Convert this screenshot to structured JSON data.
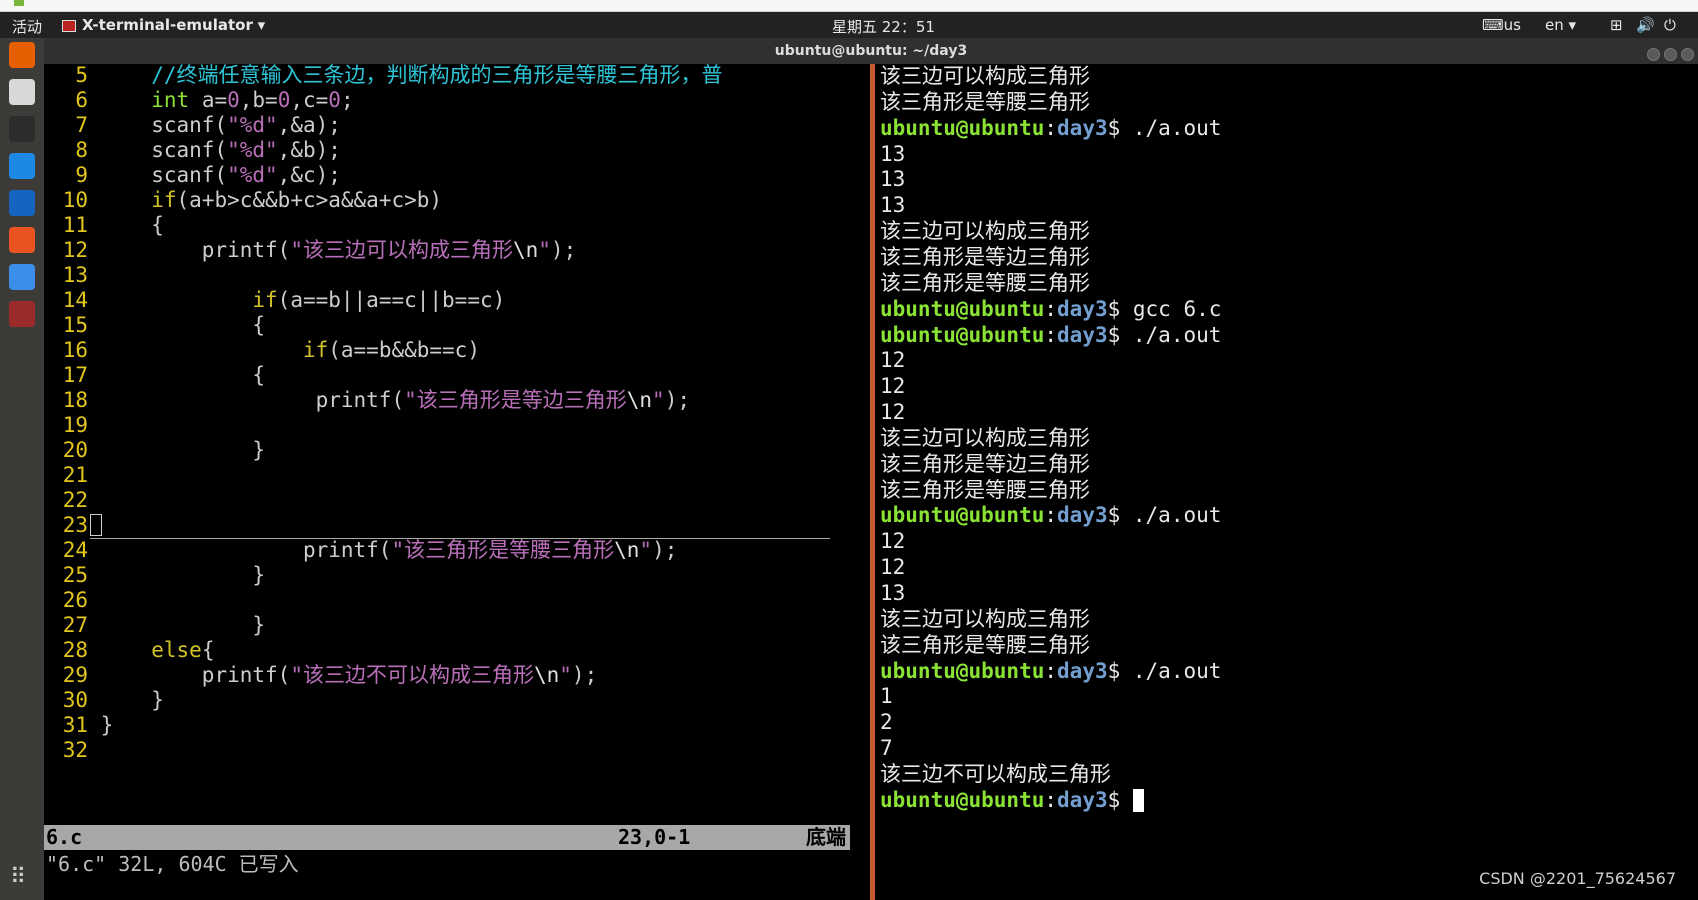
{
  "topbar": {
    "activities": "活动",
    "app_name": "X-terminal-emulator",
    "clock": "星期五 22：51",
    "kbd": "us",
    "lang": "en"
  },
  "window": {
    "title": "ubuntu@ubuntu: ~/day3"
  },
  "dock": {
    "items": [
      {
        "name": "firefox-icon",
        "color": "#e66000"
      },
      {
        "name": "files-icon",
        "color": "#d8d8d8"
      },
      {
        "name": "terminal-icon",
        "color": "#2c2c2c"
      },
      {
        "name": "vscode-icon",
        "color": "#1e88e5"
      },
      {
        "name": "vscode-alt-icon",
        "color": "#1565c0"
      },
      {
        "name": "software-center-icon",
        "color": "#e95420"
      },
      {
        "name": "settings-icon",
        "color": "#3b8eea"
      },
      {
        "name": "x-terminal-icon",
        "color": "#9b2b2b"
      }
    ],
    "apps_grid": "⠿"
  },
  "vim": {
    "lines": [
      {
        "n": "5",
        "parts": [
          [
            "    ",
            ""
          ],
          [
            "//终端任意输入三条边，判断构成的三角形是等腰三角形，普",
            "c-cmt"
          ]
        ]
      },
      {
        "n": "6",
        "parts": [
          [
            "    ",
            ""
          ],
          [
            "int",
            "c-type"
          ],
          [
            " a=",
            ""
          ],
          [
            "0",
            "c-num"
          ],
          [
            ",b=",
            ""
          ],
          [
            "0",
            "c-num"
          ],
          [
            ",c=",
            ""
          ],
          [
            "0",
            "c-num"
          ],
          [
            ";",
            ""
          ]
        ]
      },
      {
        "n": "7",
        "parts": [
          [
            "    scanf(",
            ""
          ],
          [
            "\"%d\"",
            "c-str"
          ],
          [
            ",&a);",
            ""
          ]
        ]
      },
      {
        "n": "8",
        "parts": [
          [
            "    scanf(",
            ""
          ],
          [
            "\"%d\"",
            "c-str"
          ],
          [
            ",&b);",
            ""
          ]
        ]
      },
      {
        "n": "9",
        "parts": [
          [
            "    scanf(",
            ""
          ],
          [
            "\"%d\"",
            "c-str"
          ],
          [
            ",&c);",
            ""
          ]
        ]
      },
      {
        "n": "10",
        "parts": [
          [
            "    ",
            ""
          ],
          [
            "if",
            "c-kw"
          ],
          [
            "(a+b>c&&b+c>a&&a+c>b)",
            ""
          ]
        ]
      },
      {
        "n": "11",
        "parts": [
          [
            "    {",
            ""
          ]
        ]
      },
      {
        "n": "12",
        "parts": [
          [
            "        printf(",
            ""
          ],
          [
            "\"该三边可以构成三角形",
            "c-str"
          ],
          [
            "\\n",
            "c-esc"
          ],
          [
            "\"",
            "c-str"
          ],
          [
            ");",
            ""
          ]
        ]
      },
      {
        "n": "13",
        "parts": [
          [
            "",
            ""
          ]
        ]
      },
      {
        "n": "14",
        "parts": [
          [
            "            ",
            ""
          ],
          [
            "if",
            "c-kw"
          ],
          [
            "(a==b||a==c||b==c)",
            ""
          ]
        ]
      },
      {
        "n": "15",
        "parts": [
          [
            "            {",
            ""
          ]
        ]
      },
      {
        "n": "16",
        "parts": [
          [
            "                ",
            ""
          ],
          [
            "if",
            "c-kw"
          ],
          [
            "(a==b&&b==c)",
            ""
          ]
        ]
      },
      {
        "n": "17",
        "parts": [
          [
            "            {",
            ""
          ]
        ]
      },
      {
        "n": "18",
        "parts": [
          [
            "                 printf(",
            ""
          ],
          [
            "\"该三角形是等边三角形",
            "c-str"
          ],
          [
            "\\n",
            "c-esc"
          ],
          [
            "\"",
            "c-str"
          ],
          [
            ");",
            ""
          ]
        ]
      },
      {
        "n": "19",
        "parts": [
          [
            "",
            ""
          ]
        ]
      },
      {
        "n": "20",
        "parts": [
          [
            "            }",
            ""
          ]
        ]
      },
      {
        "n": "21",
        "parts": [
          [
            "",
            ""
          ]
        ]
      },
      {
        "n": "22",
        "parts": [
          [
            "",
            ""
          ]
        ]
      },
      {
        "n": "23",
        "parts": [
          [
            "",
            ""
          ]
        ],
        "cursor": true
      },
      {
        "n": "24",
        "parts": [
          [
            "                printf(",
            ""
          ],
          [
            "\"该三角形是等腰三角形",
            "c-str"
          ],
          [
            "\\n",
            "c-esc"
          ],
          [
            "\"",
            "c-str"
          ],
          [
            ");",
            ""
          ]
        ]
      },
      {
        "n": "25",
        "parts": [
          [
            "            }",
            ""
          ]
        ]
      },
      {
        "n": "26",
        "parts": [
          [
            "",
            ""
          ]
        ]
      },
      {
        "n": "27",
        "parts": [
          [
            "            }",
            ""
          ]
        ]
      },
      {
        "n": "28",
        "parts": [
          [
            "    ",
            ""
          ],
          [
            "else",
            "c-kw"
          ],
          [
            "{",
            ""
          ]
        ]
      },
      {
        "n": "29",
        "parts": [
          [
            "        printf(",
            ""
          ],
          [
            "\"该三边不可以构成三角形",
            "c-str"
          ],
          [
            "\\n",
            "c-esc"
          ],
          [
            "\"",
            "c-str"
          ],
          [
            ");",
            ""
          ]
        ]
      },
      {
        "n": "30",
        "parts": [
          [
            "    }",
            ""
          ]
        ]
      },
      {
        "n": "31",
        "parts": [
          [
            "}",
            ""
          ]
        ]
      },
      {
        "n": "32",
        "parts": [
          [
            "",
            ""
          ]
        ]
      }
    ],
    "status_file": "6.c",
    "status_pos": "23,0-1",
    "status_where": "底端",
    "message": "\"6.c\" 32L, 604C 已写入"
  },
  "terminal": {
    "prompt_user": "ubuntu@ubuntu",
    "prompt_dir": "day3",
    "lines": [
      {
        "t": "该三边可以构成三角形"
      },
      {
        "t": "该三角形是等腰三角形"
      },
      {
        "prompt": true,
        "cmd": " ./a.out"
      },
      {
        "t": "13"
      },
      {
        "t": "13"
      },
      {
        "t": "13"
      },
      {
        "t": "该三边可以构成三角形"
      },
      {
        "t": "该三角形是等边三角形"
      },
      {
        "t": "该三角形是等腰三角形"
      },
      {
        "prompt": true,
        "cmd": " gcc 6.c"
      },
      {
        "prompt": true,
        "cmd": " ./a.out"
      },
      {
        "t": "12"
      },
      {
        "t": "12"
      },
      {
        "t": "12"
      },
      {
        "t": "该三边可以构成三角形"
      },
      {
        "t": "该三角形是等边三角形"
      },
      {
        "t": "该三角形是等腰三角形"
      },
      {
        "prompt": true,
        "cmd": " ./a.out"
      },
      {
        "t": "12"
      },
      {
        "t": "12"
      },
      {
        "t": "13"
      },
      {
        "t": "该三边可以构成三角形"
      },
      {
        "t": "该三角形是等腰三角形"
      },
      {
        "prompt": true,
        "cmd": " ./a.out"
      },
      {
        "t": "1"
      },
      {
        "t": "2"
      },
      {
        "t": "7"
      },
      {
        "t": "该三边不可以构成三角形"
      },
      {
        "prompt": true,
        "cmd": " ",
        "cursor": true
      }
    ]
  },
  "watermark": "CSDN @2201_75624567",
  "colors": {
    "comment": "#2ec4d6",
    "type": "#8ae234",
    "keyword": "#d4c427",
    "string": "#b86fb8",
    "escape": "#e0e0e0",
    "number": "#b86fb8",
    "prompt_user": "#8ae234",
    "prompt_dir": "#729fcf"
  }
}
